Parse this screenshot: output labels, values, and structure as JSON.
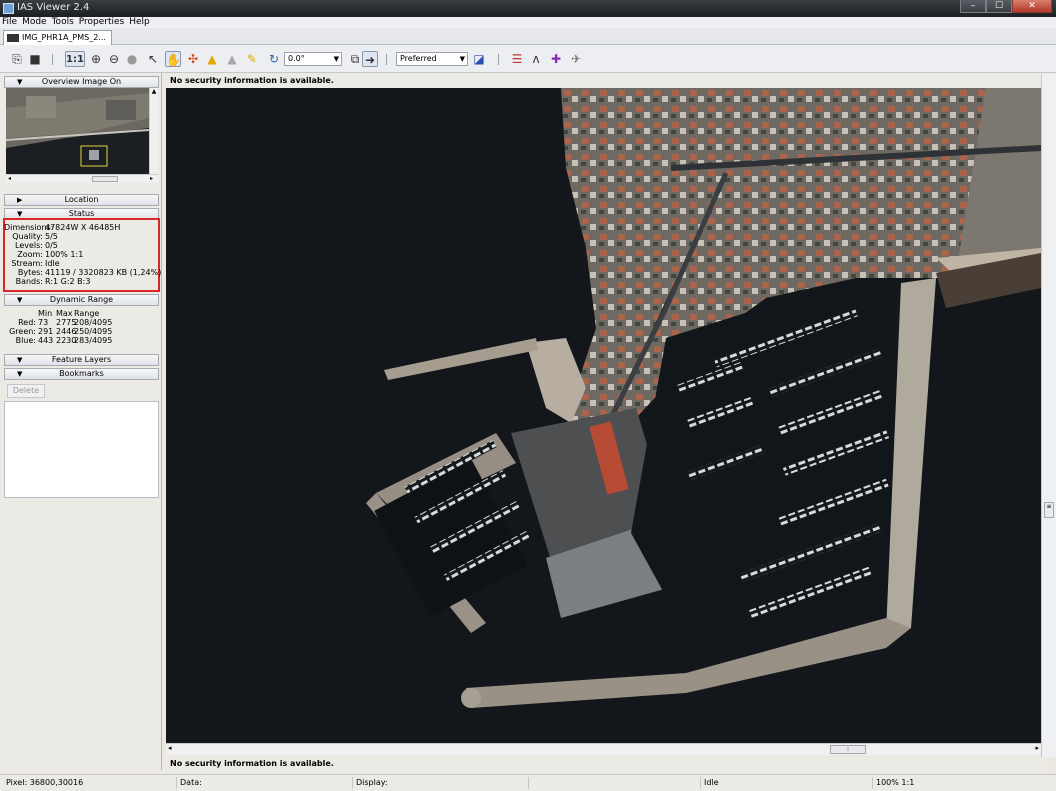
{
  "window": {
    "title": "IAS Viewer 2.4",
    "minimize": "–",
    "maximize": "☐",
    "close": "✕"
  },
  "menu": [
    "File",
    "Mode",
    "Tools",
    "Properties",
    "Help"
  ],
  "document_tab": {
    "label": "IMG_PHR1A_PMS_2..."
  },
  "toolbar": {
    "one_to_one": "1:1",
    "rotation": "0.0°",
    "band_preset": "Preferred"
  },
  "left_panel": {
    "overview": {
      "label": "Overview Image On"
    },
    "location": {
      "label": "Location"
    },
    "status": {
      "label": "Status",
      "rows": [
        {
          "key": "Dimensions:",
          "value": "47824W X 46485H"
        },
        {
          "key": "Quality:",
          "value": "5/5"
        },
        {
          "key": "Levels:",
          "value": "0/5"
        },
        {
          "key": "Zoom:",
          "value": "100% 1:1"
        },
        {
          "key": "Stream:",
          "value": "Idle"
        },
        {
          "key": "Bytes:",
          "value": "41119 / 3320823 KB (1,24%)"
        },
        {
          "key": "Bands:",
          "value": "R:1 G:2 B:3"
        }
      ]
    },
    "dynamic_range": {
      "label": "Dynamic Range",
      "header": [
        "",
        "Min",
        "Max",
        "Range"
      ],
      "rows": [
        [
          "Red:",
          "73",
          "2775",
          "208/4095"
        ],
        [
          "Green:",
          "291",
          "2446",
          "250/4095"
        ],
        [
          "Blue:",
          "443",
          "2230",
          "283/4095"
        ]
      ]
    },
    "feature_layers": {
      "label": "Feature Layers"
    },
    "bookmarks": {
      "label": "Bookmarks",
      "delete_label": "Delete"
    }
  },
  "viewer": {
    "security_top": "No security information is available.",
    "security_bottom": "No security information is available."
  },
  "statusbar": {
    "pixel": "Pixel: 36800,30016",
    "data": "Data:",
    "display": "Display:",
    "state": "Idle",
    "zoom": "100% 1:1"
  },
  "colors": {
    "highlight_box": "#d9262a",
    "title_bar": "#2a2c30"
  }
}
